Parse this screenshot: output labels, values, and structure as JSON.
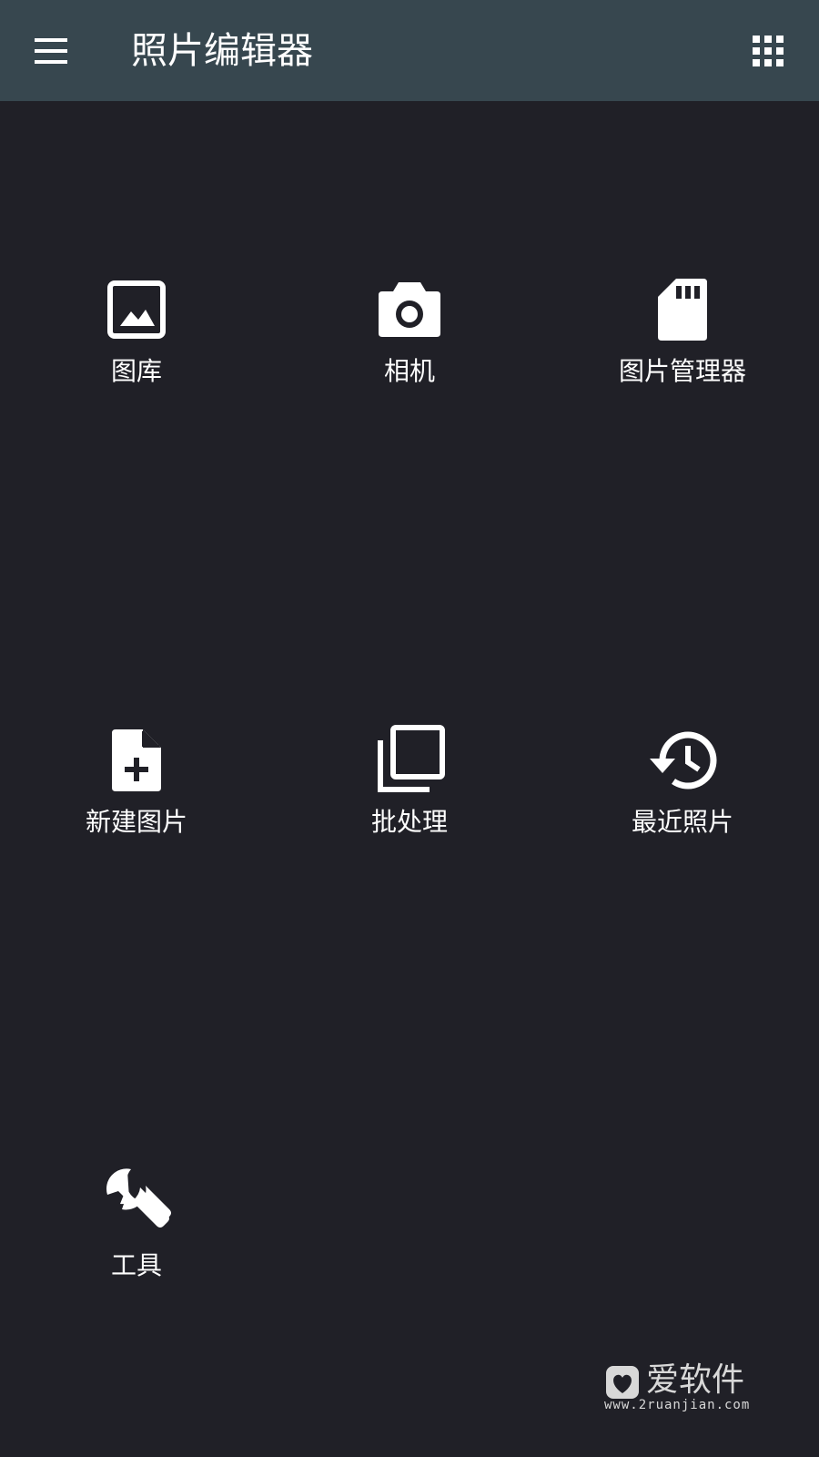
{
  "app_bar": {
    "title": "照片编辑器",
    "menu_icon": "hamburger-menu-icon",
    "apps_icon": "apps-grid-icon",
    "background": "#37474f"
  },
  "tiles": [
    {
      "label": "图库",
      "icon": "image-icon"
    },
    {
      "label": "相机",
      "icon": "camera-icon"
    },
    {
      "label": "图片管理器",
      "icon": "sd-card-icon"
    },
    {
      "label": "新建图片",
      "icon": "file-plus-icon"
    },
    {
      "label": "批处理",
      "icon": "library-stack-icon"
    },
    {
      "label": "最近照片",
      "icon": "history-icon"
    },
    {
      "label": "工具",
      "icon": "wrench-icon"
    }
  ],
  "watermark": {
    "brand": "爱软件",
    "url": "www.2ruanjian.com"
  },
  "colors": {
    "background": "#202027",
    "icon": "#ffffff",
    "text": "#ffffff"
  }
}
